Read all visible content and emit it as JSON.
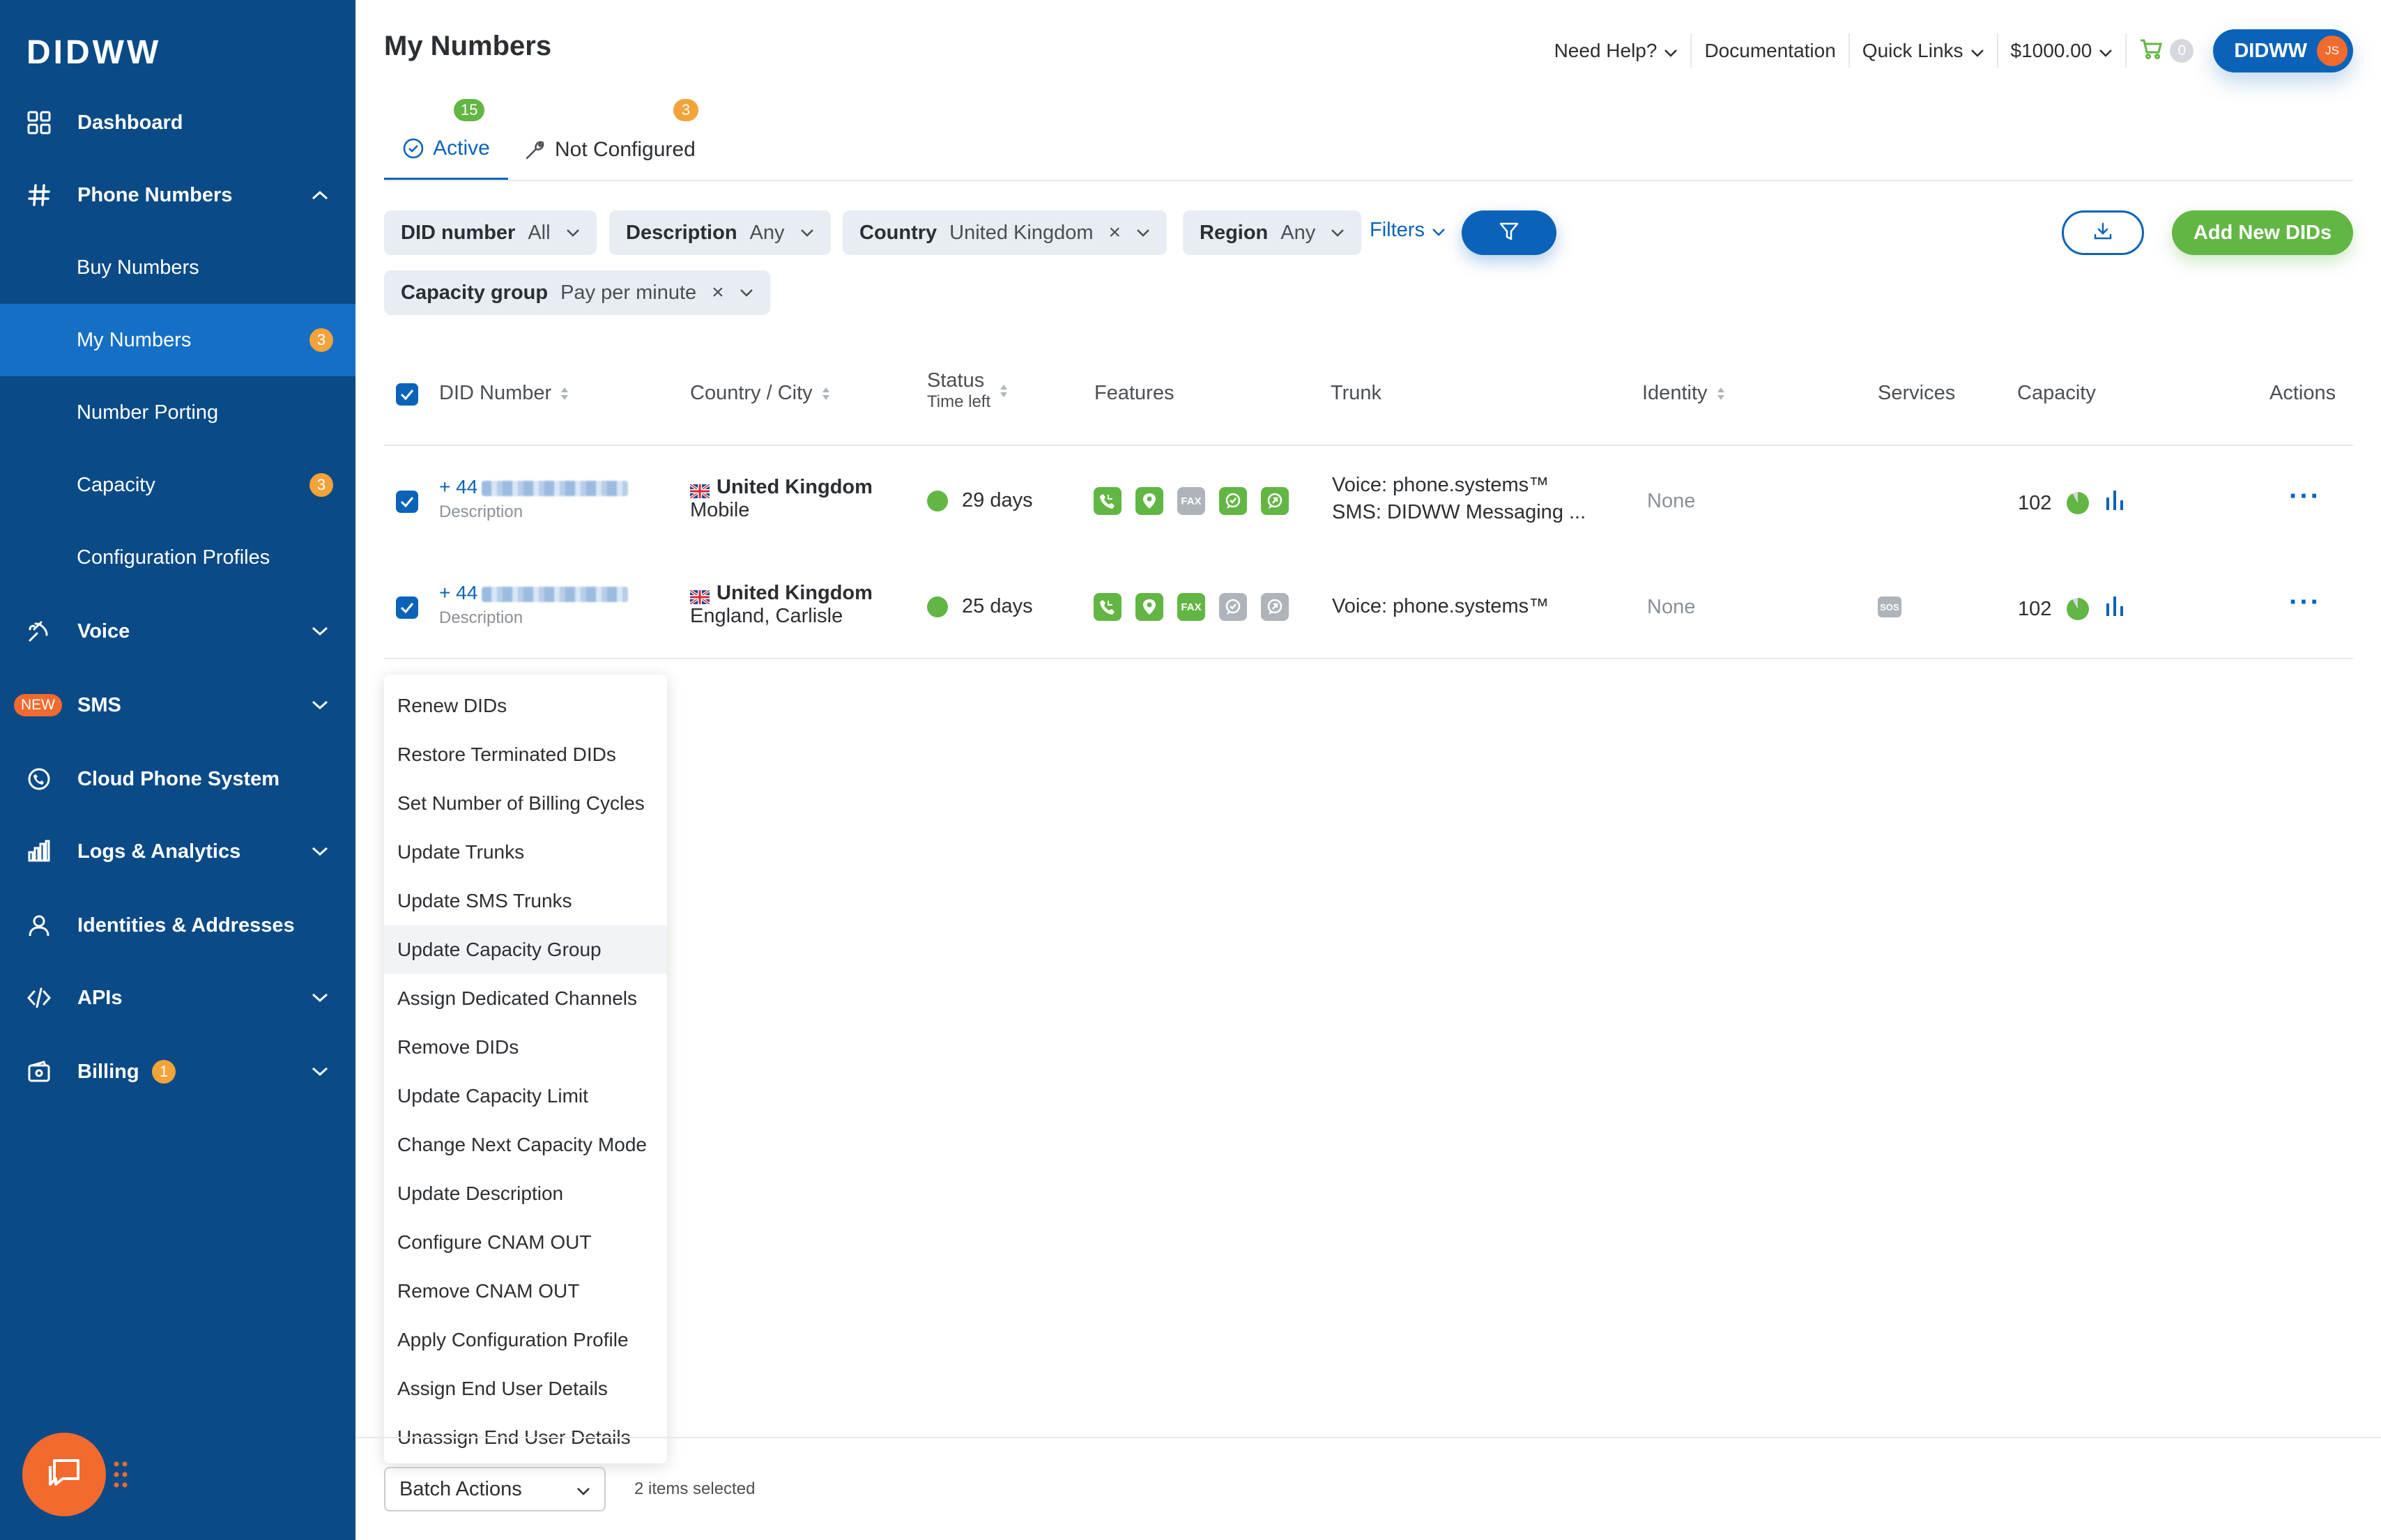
{
  "sidebar": {
    "logo": "DIDWW",
    "nav": {
      "dashboard": "Dashboard",
      "phone_numbers": "Phone Numbers",
      "voice": "Voice",
      "sms": "SMS",
      "sms_badge": "NEW",
      "cloud_phone": "Cloud Phone System",
      "logs": "Logs & Analytics",
      "identities": "Identities & Addresses",
      "apis": "APIs",
      "billing": "Billing",
      "billing_badge": "1"
    },
    "sub": {
      "buy": "Buy Numbers",
      "my": "My Numbers",
      "my_badge": "3",
      "porting": "Number Porting",
      "capacity": "Capacity",
      "capacity_badge": "3",
      "config": "Configuration Profiles"
    }
  },
  "header": {
    "title": "My Numbers",
    "help": "Need Help?",
    "docs": "Documentation",
    "quick": "Quick Links",
    "balance": "$1000.00",
    "cart_count": "0",
    "account": "DIDWW",
    "avatar": "JS"
  },
  "tabs": {
    "active": {
      "label": "Active",
      "badge": "15"
    },
    "not_configured": {
      "label": "Not Configured",
      "badge": "3"
    }
  },
  "filters": {
    "did": {
      "key": "DID number",
      "value": "All"
    },
    "description": {
      "key": "Description",
      "value": "Any"
    },
    "country": {
      "key": "Country",
      "value": "United Kingdom",
      "clear": "×"
    },
    "region": {
      "key": "Region",
      "value": "Any"
    },
    "capacity_group": {
      "key": "Capacity group",
      "value": "Pay per minute",
      "clear": "×"
    },
    "filters_link": "Filters",
    "add_button": "Add New DIDs"
  },
  "table": {
    "headers": {
      "did": "DID Number",
      "country": "Country / City",
      "status": "Status",
      "status_sub": "Time left",
      "features": "Features",
      "trunk": "Trunk",
      "identity": "Identity",
      "services": "Services",
      "capacity": "Capacity",
      "actions": "Actions"
    },
    "rows": [
      {
        "prefix": "+ 44",
        "description": "Description",
        "country": "United Kingdom",
        "city": "Mobile",
        "time_left": "29 days",
        "fax_label": "FAX",
        "trunk_voice": "Voice: phone.systems™",
        "trunk_sms": "SMS: DIDWW Messaging ...",
        "identity": "None",
        "capacity": "102",
        "actions": "···"
      },
      {
        "prefix": "+ 44",
        "description": "Description",
        "country": "United Kingdom",
        "city": "England, Carlisle",
        "time_left": "25 days",
        "fax_label": "FAX",
        "trunk_voice": "Voice: phone.systems™",
        "identity": "None",
        "service_label": "SOS",
        "capacity": "102",
        "actions": "···"
      }
    ]
  },
  "batch_menu": [
    "Renew DIDs",
    "Restore Terminated DIDs",
    "Set Number of Billing Cycles",
    "Update Trunks",
    "Update SMS Trunks",
    "Update Capacity Group",
    "Assign Dedicated Channels",
    "Remove DIDs",
    "Update Capacity Limit",
    "Change Next Capacity Mode",
    "Update Description",
    "Configure CNAM OUT",
    "Remove CNAM OUT",
    "Apply Configuration Profile",
    "Assign End User Details",
    "Unassign End User Details"
  ],
  "footer": {
    "batch_label": "Batch Actions",
    "selected": "2 items selected"
  },
  "colors": {
    "sidebar": "#0a4a87",
    "primary": "#0a63b8",
    "green": "#62b644",
    "orange": "#f26a2e",
    "badge": "#f2a33a"
  }
}
